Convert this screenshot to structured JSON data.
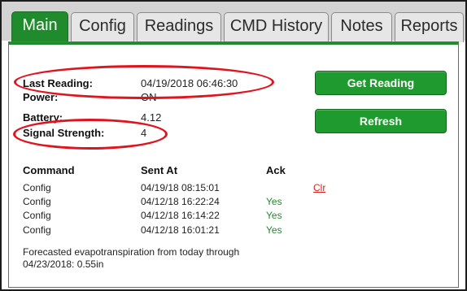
{
  "tabs": [
    {
      "label": "Main",
      "active": true
    },
    {
      "label": "Config",
      "active": false
    },
    {
      "label": "Readings",
      "active": false
    },
    {
      "label": "CMD History",
      "active": false
    },
    {
      "label": "Notes",
      "active": false
    },
    {
      "label": "Reports",
      "active": false
    }
  ],
  "status": {
    "last_reading_label": "Last Reading:",
    "last_reading_value": "04/19/2018 06:46:30",
    "power_label": "Power:",
    "power_value": "ON",
    "battery_label": "Battery:",
    "battery_value": "4.12",
    "signal_label": "Signal Strength:",
    "signal_value": "4"
  },
  "actions": {
    "get_reading_label": "Get Reading",
    "refresh_label": "Refresh"
  },
  "commands": {
    "headers": {
      "command": "Command",
      "sent_at": "Sent At",
      "ack": "Ack"
    },
    "clear_label": "Clr",
    "rows": [
      {
        "command": "Config",
        "sent_at": "04/19/18 08:15:01",
        "ack": ""
      },
      {
        "command": "Config",
        "sent_at": "04/12/18 16:22:24",
        "ack": "Yes"
      },
      {
        "command": "Config",
        "sent_at": "04/12/18 16:14:22",
        "ack": "Yes"
      },
      {
        "command": "Config",
        "sent_at": "04/12/18 16:01:21",
        "ack": "Yes"
      }
    ]
  },
  "forecast": {
    "line1": "Forecasted evapotranspiration from today through",
    "line2": "04/23/2018: 0.55in"
  },
  "colors": {
    "accent_green": "#1f8b2c",
    "ack_green": "#1f8b2c",
    "clear_red": "#d91e18",
    "highlight_red": "#e0141e"
  }
}
